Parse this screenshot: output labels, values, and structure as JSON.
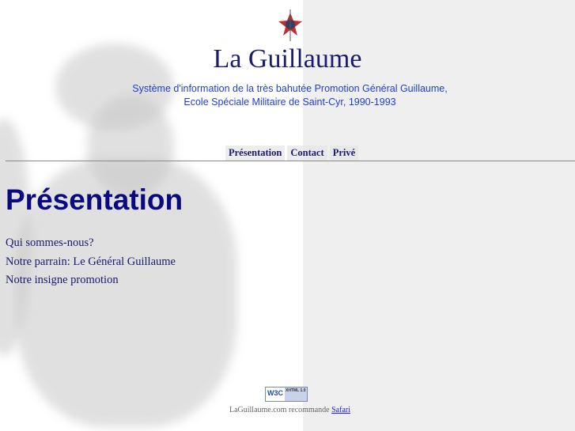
{
  "header": {
    "title": "La Guillaume",
    "subtitle_line1": "Système d'information de la très bahutée Promotion Général Guillaume,",
    "subtitle_line2": "Ecole Spéciale Militaire de Saint-Cyr, 1990-1993"
  },
  "nav": {
    "items": [
      {
        "label": "Présentation"
      },
      {
        "label": "Contact"
      },
      {
        "label": "Privé"
      }
    ]
  },
  "main": {
    "heading": "Présentation",
    "links": [
      {
        "label": "Qui sommes-nous?"
      },
      {
        "label": "Notre parrain: Le Général Guillaume"
      },
      {
        "label": "Notre insigne promotion"
      }
    ]
  },
  "footer": {
    "badge_w3c": "W3C",
    "badge_xhtml": "XHTML 1.0",
    "text": "LaGuillaume.com recommande",
    "link": "Safari"
  },
  "colors": {
    "title": "#1a1a6e",
    "subtitle": "#1f3fcf",
    "heading": "#0a0a80",
    "right_bg": "#efefef"
  }
}
